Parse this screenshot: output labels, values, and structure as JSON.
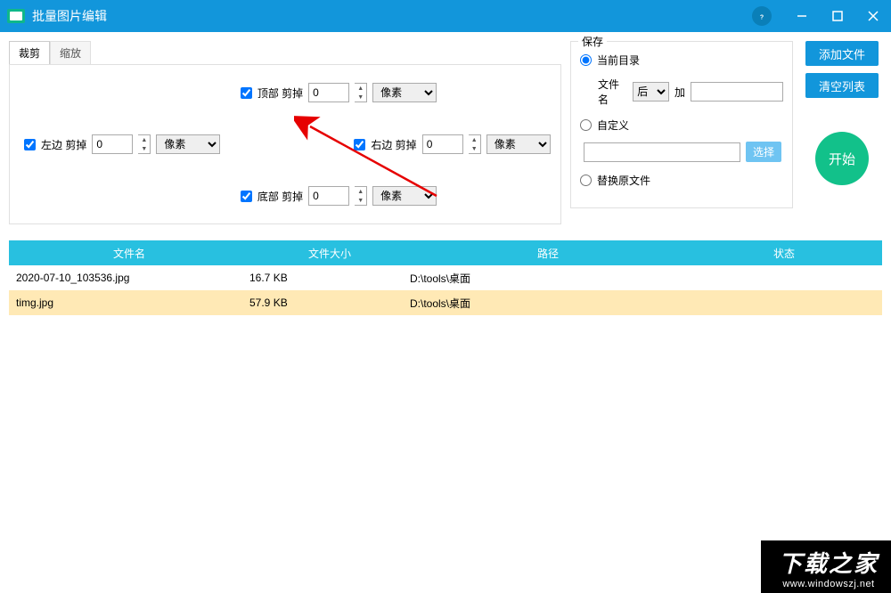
{
  "window": {
    "title": "批量图片编辑"
  },
  "tabs": {
    "crop": "裁剪",
    "scale": "缩放"
  },
  "crop": {
    "top": {
      "label": "顶部 剪掉",
      "value": "0",
      "unit": "像素",
      "checked": true
    },
    "left": {
      "label": "左边 剪掉",
      "value": "0",
      "unit": "像素",
      "checked": true
    },
    "right": {
      "label": "右边 剪掉",
      "value": "0",
      "unit": "像素",
      "checked": true
    },
    "bottom": {
      "label": "底部 剪掉",
      "value": "0",
      "unit": "像素",
      "checked": true
    }
  },
  "save": {
    "legend": "保存",
    "current_dir": "当前目录",
    "filename_label": "文件名",
    "position": "后",
    "add_label": "加",
    "suffix": "",
    "custom": "自定义",
    "custom_path": "",
    "choose": "选择",
    "replace": "替换原文件"
  },
  "actions": {
    "add": "添加文件",
    "clear": "清空列表",
    "start": "开始"
  },
  "table": {
    "headers": {
      "name": "文件名",
      "size": "文件大小",
      "path": "路径",
      "status": "状态"
    },
    "rows": [
      {
        "name": "2020-07-10_103536.jpg",
        "size": "16.7 KB",
        "path": "D:\\tools\\桌面",
        "status": ""
      },
      {
        "name": "timg.jpg",
        "size": "57.9 KB",
        "path": "D:\\tools\\桌面",
        "status": ""
      }
    ]
  },
  "watermark": {
    "big": "下载之家",
    "small": "www.windowszj.net"
  }
}
